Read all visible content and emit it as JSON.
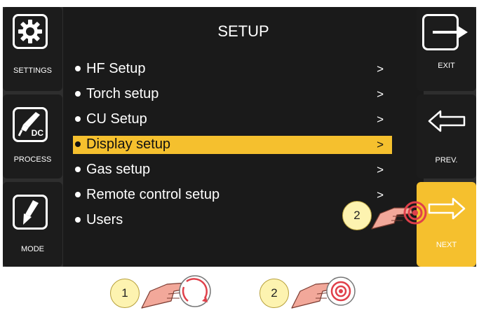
{
  "left_buttons": [
    {
      "label": "SETTINGS",
      "icon": "gear-icon"
    },
    {
      "label": "PROCESS",
      "icon": "tig-torch-icon",
      "badge": "DC"
    },
    {
      "label": "MODE",
      "icon": "torch-trigger-icon"
    }
  ],
  "right_buttons": [
    {
      "label": "EXIT",
      "icon": "exit-arrow-icon"
    },
    {
      "label": "PREV.",
      "icon": "left-arrow-icon"
    },
    {
      "label": "NEXT",
      "icon": "right-arrow-icon"
    }
  ],
  "menu": {
    "title": "SETUP",
    "items": [
      {
        "label": "HF Setup",
        "arrow": ">"
      },
      {
        "label": "Torch setup",
        "arrow": ">"
      },
      {
        "label": "CU Setup",
        "arrow": ">"
      },
      {
        "label": "Display setup",
        "arrow": ">"
      },
      {
        "label": "Gas setup",
        "arrow": ">"
      },
      {
        "label": "Remote control setup",
        "arrow": ">"
      },
      {
        "label": "Users",
        "arrow": ""
      }
    ],
    "selected_index": 3
  },
  "callouts": [
    "2",
    "1",
    "2"
  ],
  "colors": {
    "accent": "#f5c02e",
    "panel": "#1a1a1a",
    "frame": "#2e2e2e",
    "hand": "#f2a89a",
    "ring": "#e0404a"
  }
}
